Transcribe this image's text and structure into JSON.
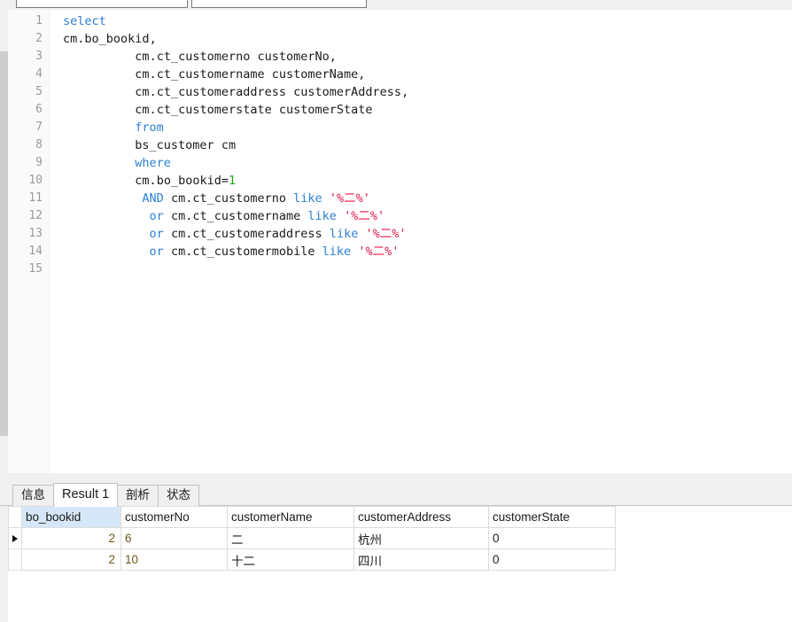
{
  "toolbar": {
    "input_one_value": "",
    "input_one_placeholder": "",
    "input_two_value": "",
    "input_two_placeholder": ""
  },
  "editor": {
    "line_numbers": [
      "1",
      "2",
      "3",
      "4",
      "5",
      "6",
      "7",
      "8",
      "9",
      "10",
      "11",
      "12",
      "13",
      "14",
      "15"
    ],
    "lines": [
      {
        "n": "1",
        "text": "select"
      },
      {
        "n": "2",
        "text": "cm.bo_bookid,"
      },
      {
        "n": "3",
        "text": "          cm.ct_customerno customerNo,"
      },
      {
        "n": "4",
        "text": "          cm.ct_customername customerName,"
      },
      {
        "n": "5",
        "text": "          cm.ct_customeraddress customerAddress,"
      },
      {
        "n": "6",
        "text": "          cm.ct_customerstate customerState"
      },
      {
        "n": "7",
        "text": "          from"
      },
      {
        "n": "8",
        "text": "          bs_customer cm"
      },
      {
        "n": "9",
        "text": "          where"
      },
      {
        "n": "10",
        "text": "          cm.bo_bookid=1"
      },
      {
        "n": "11",
        "text": "           AND cm.ct_customerno like '%二%'"
      },
      {
        "n": "12",
        "text": "            or cm.ct_customername like '%二%'"
      },
      {
        "n": "13",
        "text": "            or cm.ct_customeraddress like '%二%'"
      },
      {
        "n": "14",
        "text": "            or cm.ct_customermobile like '%二%'"
      },
      {
        "n": "15",
        "text": ""
      }
    ],
    "syntax_colors": {
      "keyword": "#2b7fd4",
      "number": "#17a81a",
      "string": "#e8154a",
      "plain": "#1a1a1a",
      "line_number": "#9a9a9a"
    }
  },
  "results_panel": {
    "tabs": [
      {
        "label": "信息",
        "active": false
      },
      {
        "label": "Result 1",
        "active": true
      },
      {
        "label": "剖析",
        "active": false
      },
      {
        "label": "状态",
        "active": false
      }
    ],
    "selected_column": "bo_bookid",
    "selected_column_color": "#d6e8f7",
    "columns": [
      "bo_bookid",
      "customerNo",
      "customerName",
      "customerAddress",
      "customerState"
    ],
    "rows": [
      {
        "current": true,
        "bo_bookid": "2",
        "customerNo": "6",
        "customerName": "二",
        "customerAddress": "杭州",
        "customerState": "0"
      },
      {
        "current": false,
        "bo_bookid": "2",
        "customerNo": "10",
        "customerName": "十二",
        "customerAddress": "四川",
        "customerState": "0"
      }
    ]
  }
}
